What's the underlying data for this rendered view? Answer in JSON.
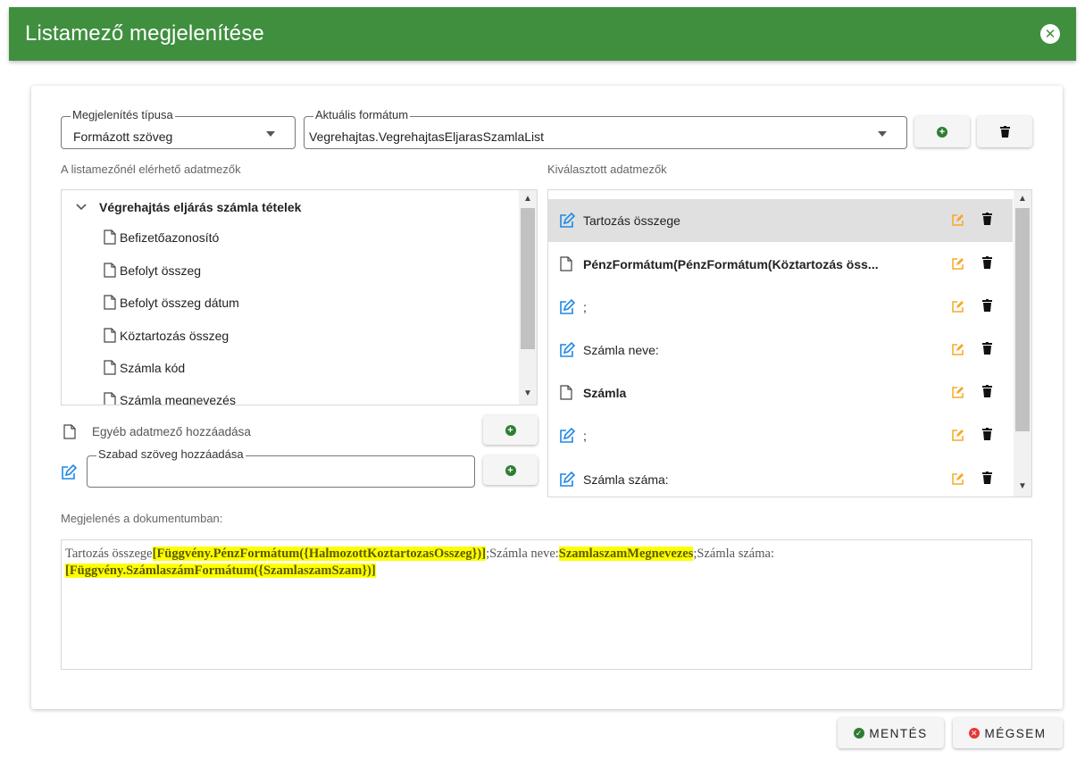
{
  "dialog": {
    "title": "Listamező megjelenítése"
  },
  "display_type": {
    "label": "Megjelenítés típusa",
    "value": "Formázott szöveg"
  },
  "current_format": {
    "label": "Aktuális formátum",
    "value": "Vegrehajtas.VegrehajtasEljarasSzamlaList"
  },
  "available_fields": {
    "label": "A listamezőnél elérhető adatmezők",
    "group": "Végrehajtás eljárás számla tételek",
    "items": [
      "Befizetőazonosító",
      "Befolyt összeg",
      "Befolyt összeg dátum",
      "Köztartozás összeg",
      "Számla kód",
      "Számla megnevezés"
    ]
  },
  "add_other_field": {
    "label": "Egyéb adatmező hozzáadása"
  },
  "free_text": {
    "label": "Szabad szöveg hozzáadása",
    "value": ""
  },
  "selected_fields": {
    "label": "Kiválasztott adatmezők",
    "items": [
      {
        "text": "Tartozás összege",
        "icon": "edit-text-icon",
        "bold": false
      },
      {
        "text": "PénzFormátum(PénzFormátum(Köztartozás öss...",
        "icon": "document-icon",
        "bold": true
      },
      {
        "text": ";",
        "icon": "edit-text-icon",
        "bold": false
      },
      {
        "text": "Számla neve:",
        "icon": "edit-text-icon",
        "bold": false
      },
      {
        "text": "Számla",
        "icon": "document-icon",
        "bold": true
      },
      {
        "text": ";",
        "icon": "edit-text-icon",
        "bold": false
      },
      {
        "text": "Számla száma:",
        "icon": "edit-text-icon",
        "bold": false
      }
    ]
  },
  "document_preview": {
    "label": "Megjelenés a dokumentumban:",
    "t1": "Tartozás összege",
    "h1": "[Függvény.PénzFormátum({HalmozottKoztartozasOsszeg})]",
    "t2": ";Számla neve:",
    "h2": "SzamlaszamMegnevezes",
    "t3": ";Számla száma:",
    "h3": "[Függvény.SzámlaszámFormátum({SzamlaszamSzam})]"
  },
  "footer": {
    "save": "MENTÉS",
    "cancel": "MÉGSEM"
  },
  "colors": {
    "header_green": "#3f8f3f",
    "add_green": "#2e7d32",
    "edit_blue": "#1e88e5",
    "edit_orange": "#f9a825",
    "cancel_red": "#e53935",
    "highlight": "#ffff00"
  }
}
